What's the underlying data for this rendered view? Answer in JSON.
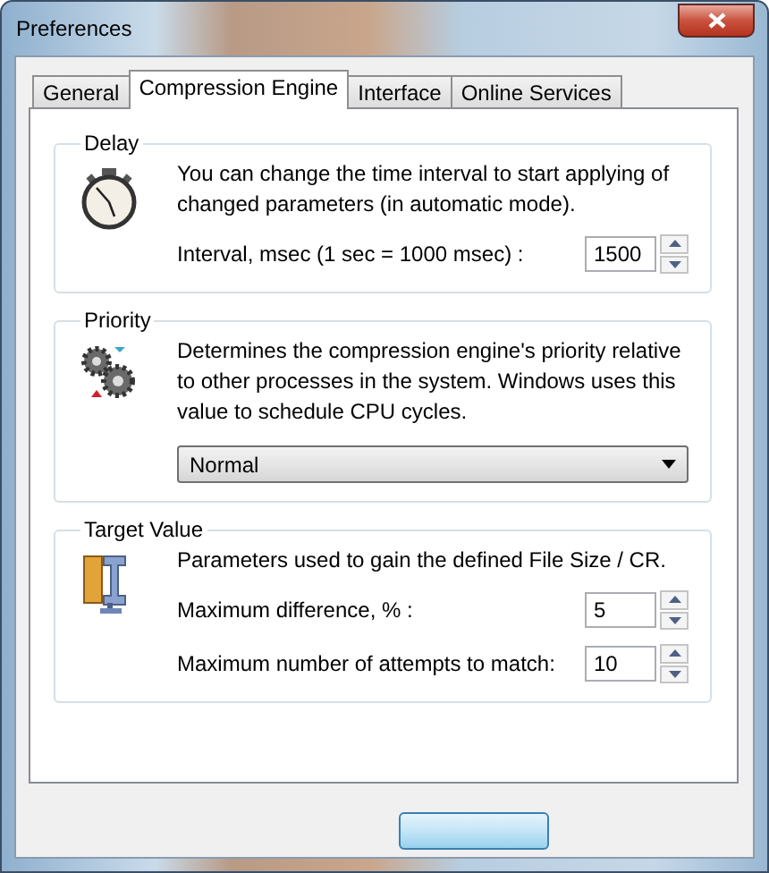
{
  "window": {
    "title": "Preferences"
  },
  "tabs": [
    {
      "label": "General",
      "selected": false
    },
    {
      "label": "Compression Engine",
      "selected": true
    },
    {
      "label": "Interface",
      "selected": false
    },
    {
      "label": "Online Services",
      "selected": false
    }
  ],
  "groups": [
    {
      "kind": "delay",
      "title": "Delay",
      "description": "You can change the time interval to start applying of changed parameters (in automatic mode).",
      "fields": [
        {
          "label": "Interval, msec (1 sec = 1000 msec) :",
          "value": "1500"
        }
      ]
    },
    {
      "kind": "priority",
      "title": "Priority",
      "description": "Determines the compression engine's priority relative to other processes in the system. Windows uses this value to schedule CPU cycles.",
      "dropdown": {
        "value": "Normal"
      }
    },
    {
      "kind": "target",
      "title": "Target Value",
      "description": "Parameters used to gain the defined File Size / CR.",
      "fields": [
        {
          "label": "Maximum difference, % :",
          "value": "5"
        },
        {
          "label": "Maximum number of attempts to match:",
          "value": "10"
        }
      ]
    }
  ]
}
